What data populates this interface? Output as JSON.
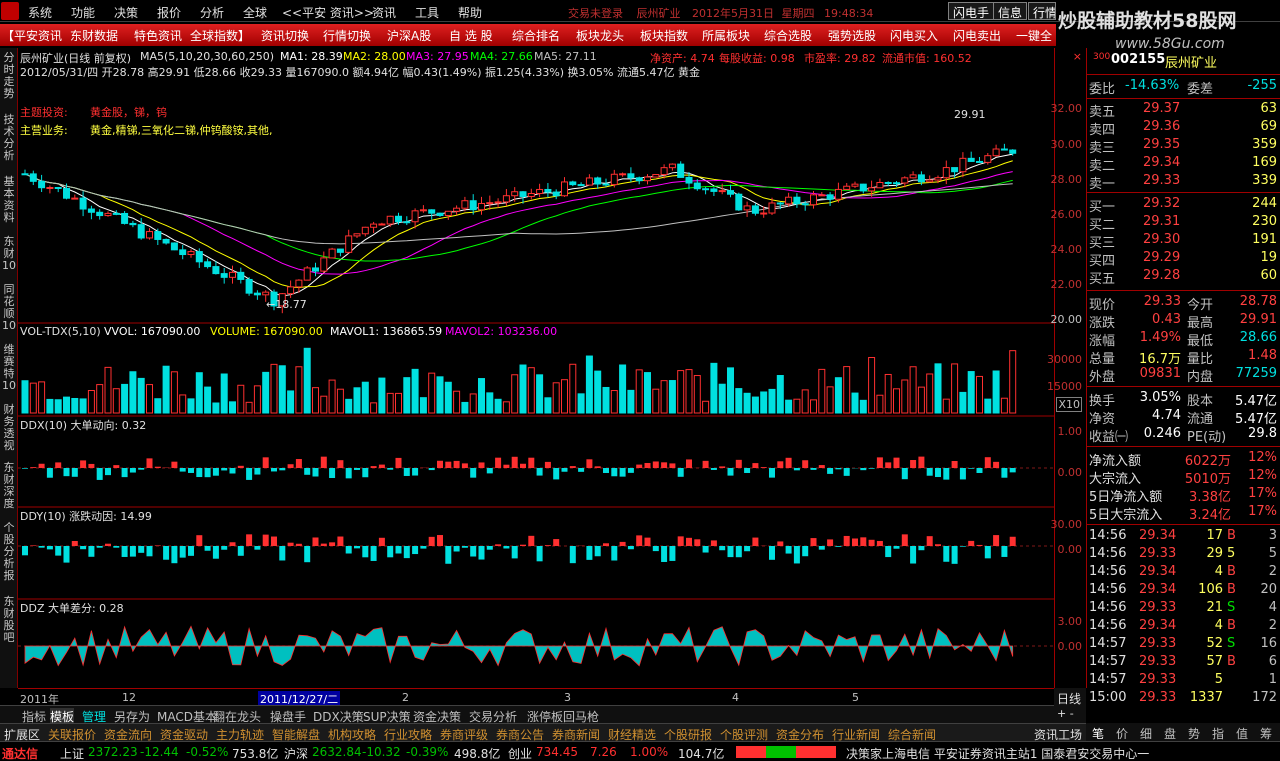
{
  "menu": [
    "系统",
    "功能",
    "决策",
    "报价",
    "分析",
    "全球",
    "<<平安 资讯>>",
    "资讯",
    "工具",
    "帮助"
  ],
  "trade_title": "交易未登录",
  "top_stock": {
    "name": "辰州矿业",
    "date": "2012年5月31日",
    "weekday": "星期四",
    "time": "19:48:34"
  },
  "top_buttons": [
    "闪电手",
    "信息",
    "行情"
  ],
  "watermark": "炒股辅助教材58股网",
  "watermark_url": "www.58Gu.com",
  "toolbar": [
    "【平安资讯",
    "东财数据",
    "特色资讯",
    "全球指数】",
    "资讯切换",
    "行情切换",
    "沪深A股",
    "自 选 股",
    "综合排名",
    "板块龙头",
    "板块指数",
    "所属板块",
    "综合选股",
    "强势选股",
    "闪电买入",
    "闪电卖出",
    "一键全"
  ],
  "left_tabs": [
    "分时走势",
    "技术分析",
    "基本资料",
    "东财10",
    "同花顺10",
    "维赛特10",
    "财务透视",
    "东财深度",
    "个股分析报",
    "东财股吧"
  ],
  "chart": {
    "title_line": "辰州矿业(日线 前复权)",
    "ma_params": "MA5(5,10,20,30,60,250)",
    "ma": [
      {
        "label": "MA1: 28.39",
        "color": "#ffffff"
      },
      {
        "label": "MA2: 28.00",
        "color": "#ffff00"
      },
      {
        "label": "MA3: 27.95",
        "color": "#ff00ff"
      },
      {
        "label": "MA4: 27.66",
        "color": "#00ff00"
      },
      {
        "label": "MA5: 27.11",
        "color": "#c0c0c0"
      }
    ],
    "fund_info": {
      "jzc": "净资产: 4.74",
      "mgsy": "每股收益: 0.98",
      "syl": "市盈率: 29.82",
      "ltsz": "流通市值: 160.52"
    },
    "info_line2": "2012/05/31/四 开28.78 高29.91 低28.66 收29.33 量167090.0 额4.94亿 幅0.43(1.49%) 振1.25(4.33%) 换3.05% 流通5.47亿 黄金",
    "theme_label": "主题投资:",
    "theme_value": "黄金股，锑，钨",
    "business_label": "主营业务:",
    "business_value": "黄金,精锑,三氧化二锑,仲钨酸铵,其他,",
    "high_label": "29.91",
    "low_label": "18.77",
    "price_axis": [
      "32.00",
      "30.00",
      "28.00",
      "26.00",
      "24.00",
      "22.00",
      "20.00"
    ],
    "vol_title": "VOL-TDX(5,10)",
    "vol_items": [
      {
        "label": "VVOL: 167090.00",
        "color": "#ffffff"
      },
      {
        "label": "VOLUME: 167090.00",
        "color": "#ffff00"
      },
      {
        "label": "MAVOL1: 136865.59",
        "color": "#ffffff"
      },
      {
        "label": "MAVOL2: 103236.00",
        "color": "#ff00ff"
      }
    ],
    "vol_axis": [
      "30000",
      "15000"
    ],
    "vol_mult": "X10",
    "ddx_title": "DDX(10) 大单动向: 0.32",
    "ddx_axis": [
      "1.00",
      "0.00"
    ],
    "ddy_title": "DDY(10) 涨跌动因: 14.99",
    "ddy_axis": [
      "30.00",
      "0.00"
    ],
    "ddz_title": "DDZ 大单差分: 0.28",
    "ddz_axis": [
      "3.00",
      "0.00"
    ],
    "dates": [
      "2011年",
      "12",
      "2011/12/27/二",
      "2",
      "3",
      "4",
      "5"
    ],
    "period_button": "日线"
  },
  "quote": {
    "code": "002155",
    "name": "辰州矿业",
    "wb": {
      "label": "委比",
      "value": "-14.63%",
      "label2": "委差",
      "value2": "-255"
    },
    "sells": [
      {
        "label": "卖五",
        "price": "29.37",
        "vol": "63"
      },
      {
        "label": "卖四",
        "price": "29.36",
        "vol": "69"
      },
      {
        "label": "卖三",
        "price": "29.35",
        "vol": "359"
      },
      {
        "label": "卖二",
        "price": "29.34",
        "vol": "169"
      },
      {
        "label": "卖一",
        "price": "29.33",
        "vol": "339"
      }
    ],
    "buys": [
      {
        "label": "买一",
        "price": "29.32",
        "vol": "244"
      },
      {
        "label": "买二",
        "price": "29.31",
        "vol": "230"
      },
      {
        "label": "买三",
        "price": "29.30",
        "vol": "191"
      },
      {
        "label": "买四",
        "price": "29.29",
        "vol": "19"
      },
      {
        "label": "买五",
        "price": "29.28",
        "vol": "60"
      }
    ],
    "stats": [
      {
        "l1": "现价",
        "v1": "29.33",
        "c1": "#ff4040",
        "l2": "今开",
        "v2": "28.78",
        "c2": "#ff4040"
      },
      {
        "l1": "涨跌",
        "v1": "0.43",
        "c1": "#ff4040",
        "l2": "最高",
        "v2": "29.91",
        "c2": "#ff4040"
      },
      {
        "l1": "涨幅",
        "v1": "1.49%",
        "c1": "#ff4040",
        "l2": "最低",
        "v2": "28.66",
        "c2": "#00e0e0"
      },
      {
        "l1": "总量",
        "v1": "16.7万",
        "c1": "#ffff60",
        "l2": "量比",
        "v2": "1.48",
        "c2": "#ff4040"
      },
      {
        "l1": "外盘",
        "v1": "09831",
        "c1": "#ff4040",
        "l2": "内盘",
        "v2": "77259",
        "c2": "#00e0e0"
      }
    ],
    "stats2": [
      {
        "l1": "换手",
        "v1": "3.05%",
        "c1": "#ffffff",
        "l2": "股本",
        "v2": "5.47亿",
        "c2": "#ffffff"
      },
      {
        "l1": "净资",
        "v1": "4.74",
        "c1": "#ffffff",
        "l2": "流通",
        "v2": "5.47亿",
        "c2": "#ffffff"
      },
      {
        "l1": "收益㈠",
        "v1": "0.246",
        "c1": "#ffffff",
        "l2": "PE(动)",
        "v2": "29.8",
        "c2": "#ffffff"
      }
    ],
    "flows": [
      {
        "label": "净流入额",
        "value": "6022万",
        "pct": "12%"
      },
      {
        "label": "大宗流入",
        "value": "5010万",
        "pct": "12%"
      },
      {
        "label": "5日净流入额",
        "value": "3.38亿",
        "pct": "17%"
      },
      {
        "label": "5日大宗流入",
        "value": "3.24亿",
        "pct": "17%"
      }
    ],
    "ticks": [
      {
        "t": "14:56",
        "p": "29.34",
        "pc": "#ff4040",
        "v": "17",
        "bs": "B",
        "bc": "#ff4040",
        "n": "3"
      },
      {
        "t": "14:56",
        "p": "29.33",
        "pc": "#ff4040",
        "v": "29",
        "bs": "5",
        "bc": "#ffff60",
        "n": "5"
      },
      {
        "t": "14:56",
        "p": "29.34",
        "pc": "#ff4040",
        "v": "4",
        "bs": "B",
        "bc": "#ff4040",
        "n": "2"
      },
      {
        "t": "14:56",
        "p": "29.34",
        "pc": "#ff4040",
        "v": "106",
        "bs": "B",
        "bc": "#ff4040",
        "n": "20"
      },
      {
        "t": "14:56",
        "p": "29.33",
        "pc": "#ff4040",
        "v": "21",
        "bs": "S",
        "bc": "#00e000",
        "n": "4"
      },
      {
        "t": "14:56",
        "p": "29.34",
        "pc": "#ff4040",
        "v": "4",
        "bs": "B",
        "bc": "#ff4040",
        "n": "2"
      },
      {
        "t": "14:57",
        "p": "29.33",
        "pc": "#ff4040",
        "v": "52",
        "bs": "S",
        "bc": "#00e000",
        "n": "16"
      },
      {
        "t": "14:57",
        "p": "29.33",
        "pc": "#ff4040",
        "v": "57",
        "bs": "B",
        "bc": "#ff4040",
        "n": "6"
      },
      {
        "t": "14:57",
        "p": "29.33",
        "pc": "#ff4040",
        "v": "5",
        "bs": "",
        "bc": "#ff4040",
        "n": "1"
      },
      {
        "t": "15:00",
        "p": "29.33",
        "pc": "#ff4040",
        "v": "1337",
        "bs": "",
        "bc": "#ff4040",
        "n": "172"
      }
    ]
  },
  "bottom1": [
    "指标",
    "模板",
    "管理",
    "另存为",
    "MACD基本",
    "翻在龙头",
    "操盘手",
    "DDX决策",
    "SUP决策",
    "资金决策",
    "交易分析",
    "涨停板回马枪"
  ],
  "bottom2": [
    "扩展区",
    "关联报价",
    "资金流向",
    "资金驱动",
    "主力轨迹",
    "智能解盘",
    "机构攻略",
    "行业攻略",
    "券商评级",
    "券商公告",
    "券商新闻",
    "财经精选",
    "个股研报",
    "个股评测",
    "资金分布",
    "行业新闻",
    "综合新闻",
    "资讯工场"
  ],
  "right_tabs": [
    "笔",
    "价",
    "细",
    "盘",
    "势",
    "指",
    "值",
    "筹"
  ],
  "status": {
    "brand": "通达信",
    "sh": {
      "name": "上证",
      "value": "2372.23",
      "chg": "-12.44",
      "pct": "-0.52%",
      "amt": "753.8亿"
    },
    "hs": {
      "name": "沪深",
      "value": "2632.84",
      "chg": "-10.32",
      "pct": "-0.39%",
      "amt": "498.8亿"
    },
    "cy": {
      "name": "创业",
      "value": "734.45",
      "chg": "7.26",
      "pct": "1.00%",
      "amt": "104.7亿"
    },
    "ticker": "决策家上海电信  平安证券资讯主站1  国泰君安交易中心一"
  }
}
